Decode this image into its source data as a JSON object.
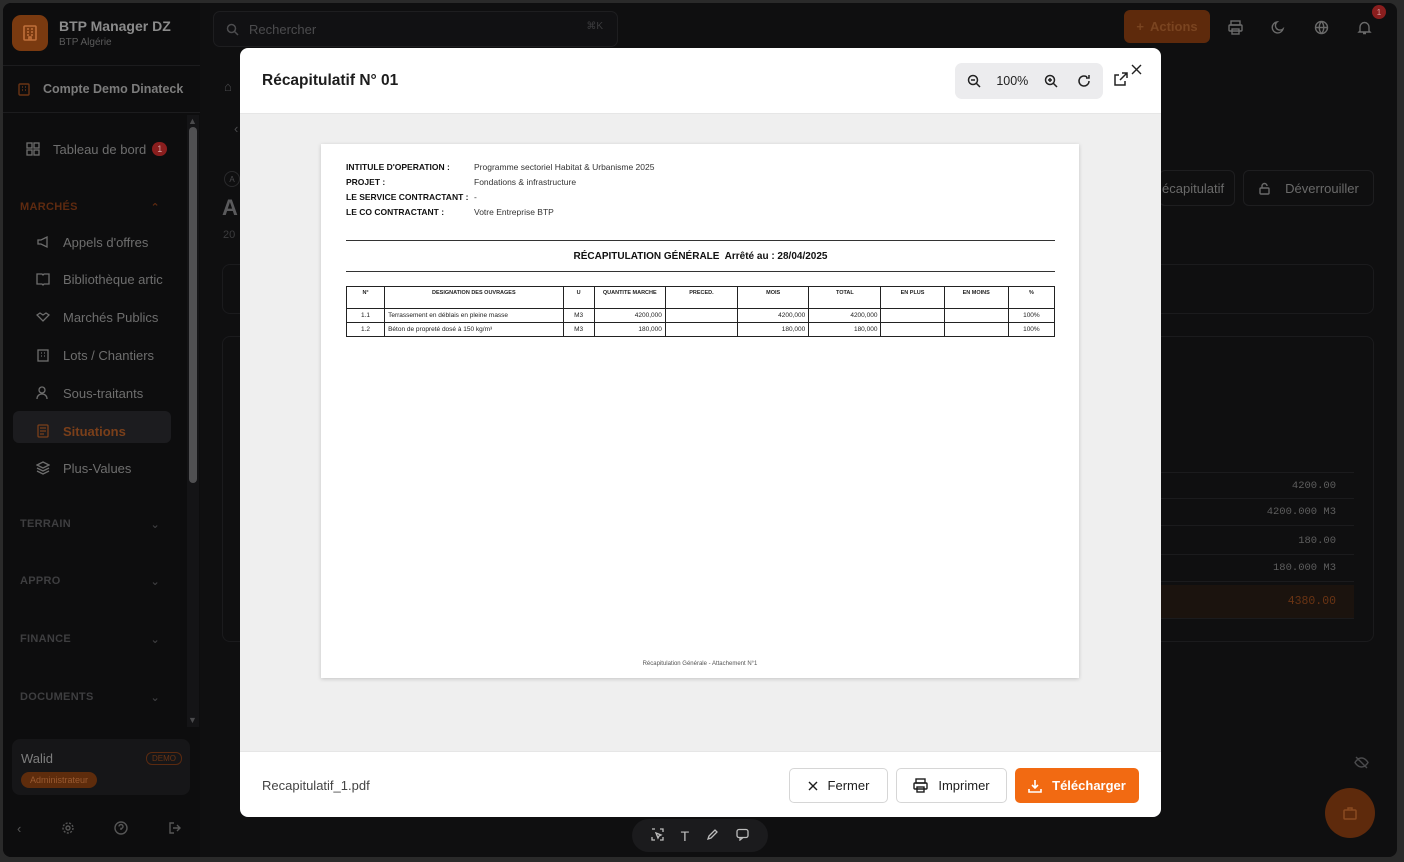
{
  "brand": {
    "name": "BTP Manager DZ",
    "subtitle": "BTP Algérie"
  },
  "account": {
    "label": "Compte Demo Dinateck"
  },
  "nav": {
    "dashboard": {
      "label": "Tableau de bord",
      "badge": "1"
    },
    "sections": {
      "marches": "MARCHÉS",
      "terrain": "TERRAIN",
      "appro": "APPRO",
      "finance": "FINANCE",
      "documents": "DOCUMENTS"
    },
    "items": [
      {
        "label": "Appels d'offres"
      },
      {
        "label": "Bibliothèque artic"
      },
      {
        "label": "Marchés Publics"
      },
      {
        "label": "Lots / Chantiers"
      },
      {
        "label": "Sous-traitants"
      },
      {
        "label": "Situations"
      },
      {
        "label": "Plus-Values"
      }
    ]
  },
  "user": {
    "name": "Walid",
    "tag": "DEMO",
    "role": "Administrateur"
  },
  "search": {
    "placeholder": "Rechercher",
    "shortcut": "⌘K"
  },
  "topbar": {
    "actions_label": "Actions",
    "notif_count": "1"
  },
  "background": {
    "recap_btn": "écapitulatif",
    "unlock_btn": "Déverrouiller",
    "title_frag": "A",
    "sub_frag": "20",
    "chip_frag": "A",
    "rows": [
      "4200.00",
      "4200.000 M3",
      "180.00",
      "180.000 M3"
    ],
    "total": "4380.00"
  },
  "modal": {
    "title": "Récapitulatif N° 01",
    "zoom": "100%",
    "file_name": "Recapitulatif_1.pdf",
    "close_label": "Fermer",
    "print_label": "Imprimer",
    "download_label": "Télécharger"
  },
  "document": {
    "meta": [
      {
        "key": "INTITULE D'OPERATION :",
        "value": "Programme sectoriel Habitat & Urbanisme 2025"
      },
      {
        "key": "PROJET :",
        "value": "Fondations & infrastructure"
      },
      {
        "key": "LE SERVICE CONTRACTANT :",
        "value": "-"
      },
      {
        "key": "LE CO CONTRACTANT :",
        "value": "Votre Entreprise BTP"
      }
    ],
    "title": "RÉCAPITULATION GÉNÉRALE",
    "arrete": "Arrêté au : 28/04/2025",
    "columns": [
      "N°",
      "DESIGNATION DES OUVRAGES",
      "U",
      "QUANTITE MARCHE",
      "PRECED.",
      "MOIS",
      "TOTAL",
      "EN PLUS",
      "EN MOINS",
      "%"
    ],
    "rows": [
      {
        "n": "1.1",
        "designation": "Terrassement en déblais en pleine masse",
        "u": "M3",
        "qte": "4200,000",
        "preced": "",
        "mois": "4200,000",
        "total": "4200,000",
        "plus": "",
        "moins": "",
        "pct": "100%"
      },
      {
        "n": "1.2",
        "designation": "Béton de propreté dosé à 150 kg/m³",
        "u": "M3",
        "qte": "180,000",
        "preced": "",
        "mois": "180,000",
        "total": "180,000",
        "plus": "",
        "moins": "",
        "pct": "100%"
      }
    ],
    "footer": "Récapitulation Générale - Attachement N°1"
  },
  "colors": {
    "accent": "#f26a12",
    "dark_bg": "#0f0f10"
  }
}
